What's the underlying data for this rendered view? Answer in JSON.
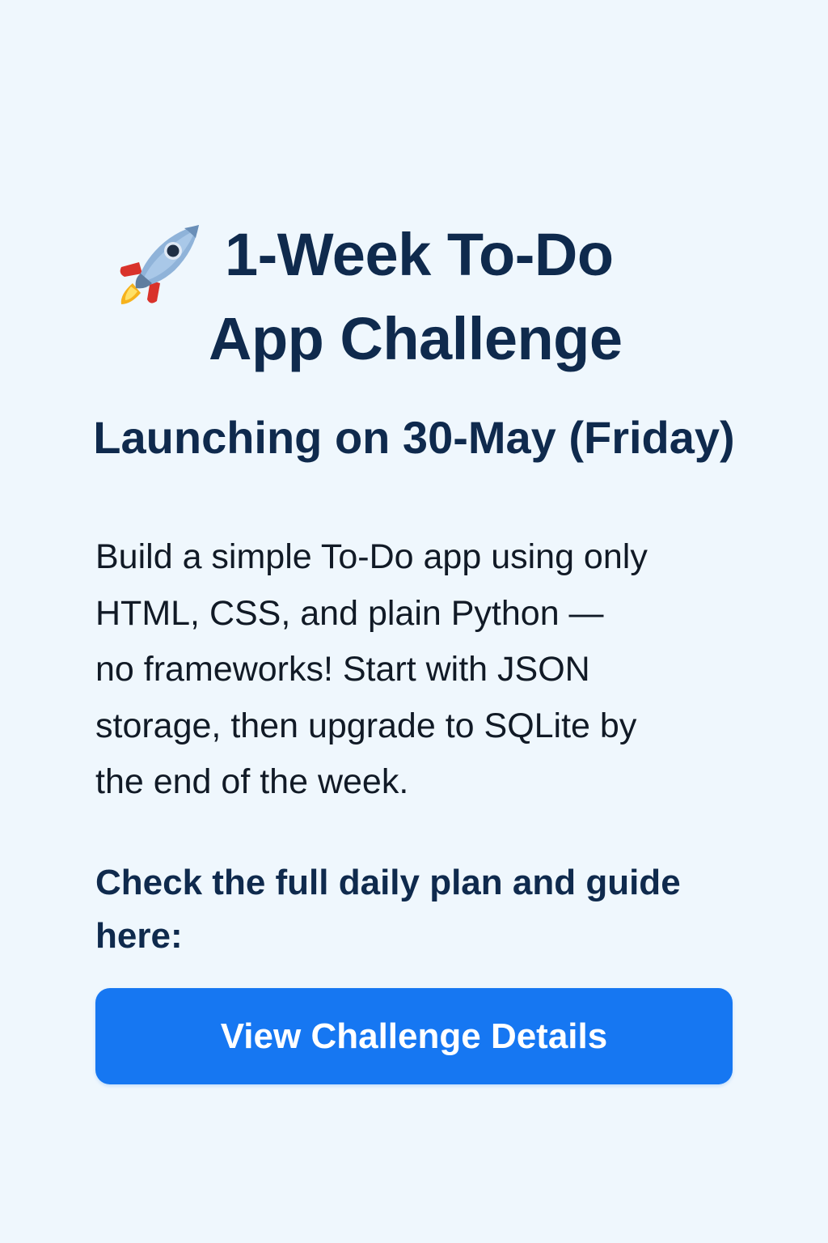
{
  "header": {
    "icon": "rocket-icon",
    "title_line_1": "1-Week To-Do",
    "title_line_2": "App Challenge",
    "subtitle": "Launching on 30-May (Friday)"
  },
  "body": {
    "description": "Build a simple To-Do app using only\nHTML, CSS, and plain Python —\nno frameworks! Start with JSON\nstorage, then upgrade to SQLite by\nthe end of the week.",
    "cta_prompt": "Check the full daily plan and guide here:"
  },
  "cta": {
    "label": "View Challenge Details"
  },
  "colors": {
    "background": "#eff7fd",
    "heading": "#0f2a4d",
    "button": "#1677f2",
    "button_text": "#ffffff"
  }
}
